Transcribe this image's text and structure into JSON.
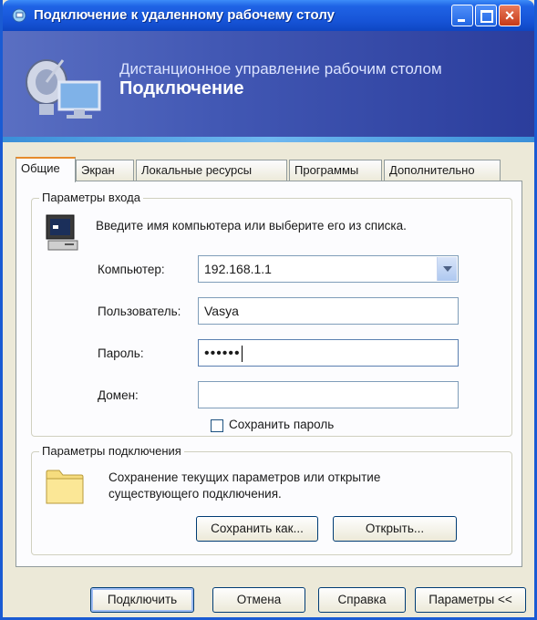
{
  "window": {
    "title": "Подключение к удаленному рабочему столу",
    "accent": "#1653d6"
  },
  "banner": {
    "subtitle": "Дистанционное управление рабочим столом",
    "title": "Подключение"
  },
  "tabs": [
    {
      "label": "Общие",
      "active": true
    },
    {
      "label": "Экран"
    },
    {
      "label": "Локальные ресурсы"
    },
    {
      "label": "Программы"
    },
    {
      "label": "Дополнительно"
    }
  ],
  "login": {
    "group_label": "Параметры входа",
    "hint": "Введите имя компьютера или выберите его из списка.",
    "computer_label": "Компьютер:",
    "computer_value": "192.168.1.1",
    "user_label": "Пользователь:",
    "user_value": "Vasya",
    "password_label": "Пароль:",
    "password_value": "••••••",
    "domain_label": "Домен:",
    "domain_value": "",
    "save_password_label": "Сохранить пароль",
    "save_password_checked": false
  },
  "connection": {
    "group_label": "Параметры подключения",
    "description_line1": "Сохранение текущих параметров или открытие",
    "description_line2": "существующего подключения.",
    "save_as_label": "Сохранить как...",
    "open_label": "Открыть..."
  },
  "footer": {
    "connect_label": "Подключить",
    "cancel_label": "Отмена",
    "help_label": "Справка",
    "options_label": "Параметры <<"
  },
  "icons": [
    "remote-desktop-icon",
    "computer-icon",
    "folder-icon",
    "dropdown-arrow-icon",
    "minimize-icon",
    "maximize-icon",
    "close-icon"
  ]
}
